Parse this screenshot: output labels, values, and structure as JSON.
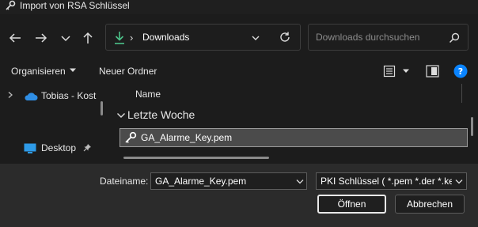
{
  "window": {
    "title": "Import von RSA Schlüssel",
    "icon": "key-icon"
  },
  "nav": {
    "back_icon": "arrow-left-icon",
    "forward_icon": "arrow-right-icon",
    "recent_icon": "chevron-down-icon",
    "up_icon": "arrow-up-icon",
    "address": {
      "icon": "download-icon",
      "separator": "›",
      "path": "Downloads"
    },
    "search": {
      "placeholder": "Downloads durchsuchen",
      "icon": "search-icon"
    }
  },
  "toolbar": {
    "organize_label": "Organisieren",
    "new_folder_label": "Neuer Ordner",
    "view_icon": "details-view-icon",
    "preview_icon": "preview-pane-icon",
    "help_icon": "help-icon"
  },
  "sidebar": {
    "items": [
      {
        "label": "Tobias - Kost",
        "icon": "onedrive-cloud-icon"
      },
      {
        "label": "Desktop",
        "icon": "desktop-icon"
      }
    ]
  },
  "list": {
    "column_name": "Name",
    "groups": [
      {
        "label": "Letzte Woche",
        "files": [
          {
            "name": "GA_Alarme_Key.pem",
            "icon": "certificate-key-icon"
          }
        ]
      }
    ]
  },
  "bottom": {
    "filename_label": "Dateiname:",
    "filename_value": "GA_Alarme_Key.pem",
    "filter_value": "PKI Schlüssel ( *.pem *.der *.key",
    "open_label": "Öffnen",
    "cancel_label": "Abbrechen"
  },
  "colors": {
    "background": "#1c1c1c",
    "bottom_panel": "#2b2b2b",
    "selection": "#4b4b4b",
    "accent_green": "#4cc38a",
    "help_blue": "#0a84ff"
  }
}
